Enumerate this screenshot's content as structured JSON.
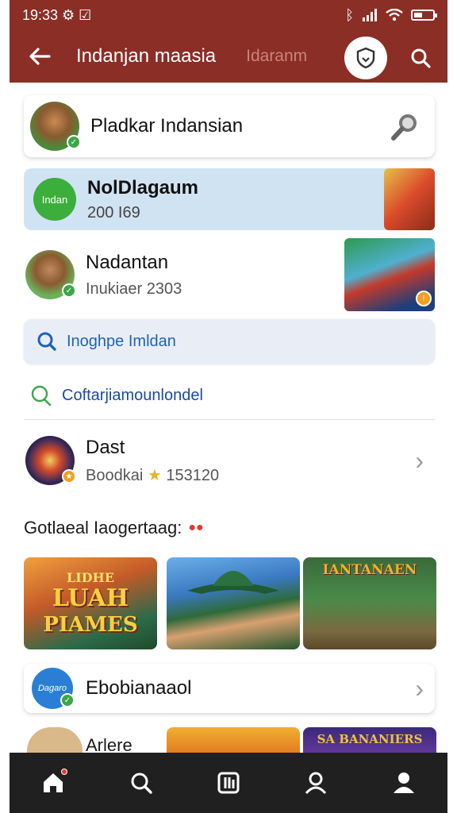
{
  "status": {
    "time": "19:33 ⚙ ☑"
  },
  "appbar": {
    "title": "Indanjan maasia",
    "subtitle": "Idaranm",
    "back_icon": "arrow-left-icon",
    "shield_icon": "shield-icon",
    "search_icon": "search-icon"
  },
  "profile_card": {
    "title": "Pladkar Indansian"
  },
  "highlight_card": {
    "logo_text": "Indan",
    "title": "NolDlagaum",
    "subtitle": "200 I69"
  },
  "user_card": {
    "title": "Nadantan",
    "subtitle": "Inukiaer 2303"
  },
  "search": {
    "placeholder": "Inoghpe Imldan"
  },
  "filter": {
    "label": "Coftarjiamounlondel"
  },
  "dast_card": {
    "title": "Dast",
    "subtitle": "Boodkai",
    "star": "★",
    "count": "153120"
  },
  "section": {
    "title": "Gotlaeal Iaogertaag:",
    "dots": "●●"
  },
  "tiles": [
    {
      "title_top": "LIDHE",
      "title_mid": "LUAH",
      "title_bottom": "PIAMES"
    },
    {
      "title": ""
    },
    {
      "title": "IANTANAEN"
    }
  ],
  "list_card": {
    "avatar_text": "Dagaro",
    "title": "Ebobianaaol"
  },
  "partial": {
    "title": "Arlere",
    "tile3_title": "SA BANANIERS"
  },
  "nav": [
    "home-icon",
    "search-icon",
    "library-icon",
    "person-outline-icon",
    "profile-icon"
  ],
  "colors": {
    "brand": "#8b2e25",
    "highlight": "#cfe3f3",
    "nav_bg": "#202020",
    "accent_green": "#3aa84a"
  }
}
